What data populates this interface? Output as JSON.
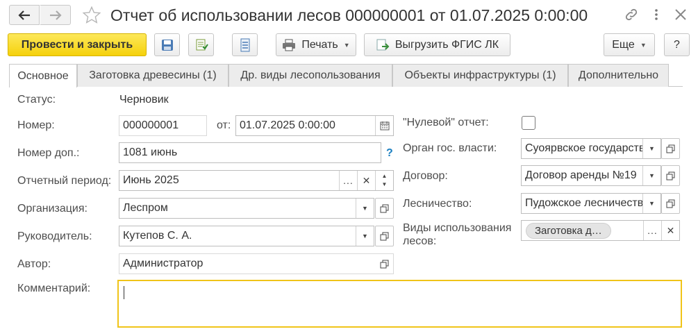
{
  "window": {
    "title": "Отчет об использовании лесов 000000001 от 01.07.2025 0:00:00",
    "back_icon": "arrow-left-icon",
    "forward_icon": "arrow-right-icon",
    "favorite_icon": "star-icon",
    "link_icon": "link-icon",
    "menu_icon": "more-vertical-icon",
    "close_icon": "close-icon"
  },
  "toolbar": {
    "post_close_label": "Провести и закрыть",
    "print_label": "Печать",
    "export_label": "Выгрузить ФГИС ЛК",
    "more_label": "Еще",
    "help_label": "?"
  },
  "tabs": [
    {
      "label": "Основное"
    },
    {
      "label": "Заготовка древесины (1)"
    },
    {
      "label": "Др. виды лесопользования"
    },
    {
      "label": "Объекты инфраструктуры (1)"
    },
    {
      "label": "Дополнительно"
    }
  ],
  "form": {
    "status_label": "Статус:",
    "status_value": "Черновик",
    "number_label": "Номер:",
    "number_value": "000000001",
    "date_label": "от:",
    "date_value": "01.07.2025  0:00:00",
    "extra_number_label": "Номер доп.:",
    "extra_number_value": "1081 июнь",
    "extra_number_help": "?",
    "period_label": "Отчетный период:",
    "period_value": "Июнь 2025",
    "org_label": "Организация:",
    "org_value": "Леспром",
    "head_label": "Руководитель:",
    "head_value": "Кутепов С. А.",
    "author_label": "Автор:",
    "author_value": "Администратор",
    "comment_label": "Комментарий:",
    "comment_value": "",
    "zero_report_label": "\"Нулевой\" отчет:",
    "zero_report_checked": false,
    "authority_label": "Орган гос. власти:",
    "authority_value": "Суоярвское государственное",
    "contract_label": "Договор:",
    "contract_value": "Договор аренды №19",
    "forestry_label": "Лесничество:",
    "forestry_value": "Пудожское лесничество",
    "usage_label_line1": "Виды использования",
    "usage_label_line2": "лесов:",
    "usage_chip": "Заготовка д…"
  },
  "colors": {
    "primary_button": "#f5d10b",
    "comment_focus_border": "#f0c419",
    "help_blue": "#1a7fc1"
  }
}
